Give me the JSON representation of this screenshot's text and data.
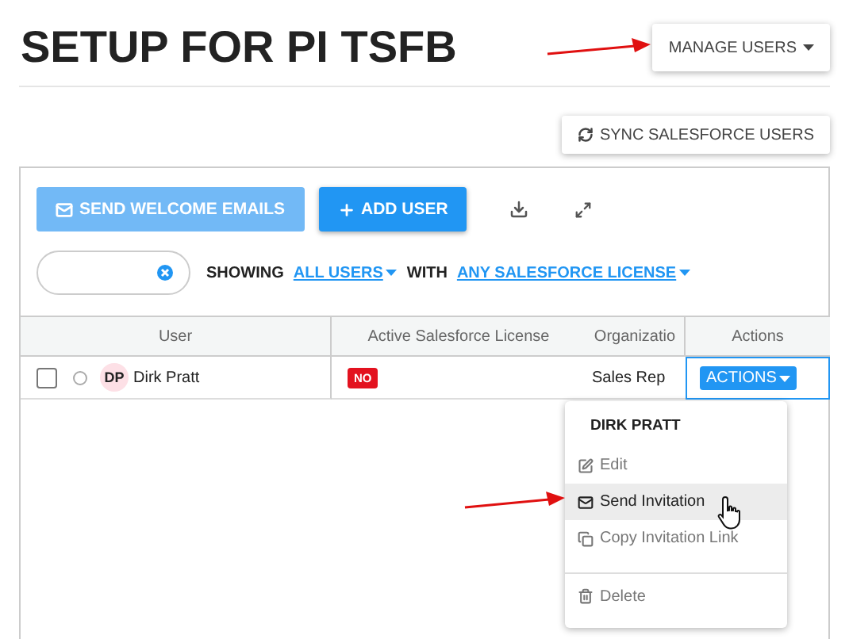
{
  "page": {
    "title": "SETUP FOR PI TSFB"
  },
  "manage_button": {
    "label": "MANAGE USERS"
  },
  "sync_button": {
    "label": "SYNC SALESFORCE USERS"
  },
  "toolbar": {
    "buttons": [
      {
        "label": "SEND WELCOME EMAILS",
        "kind": "email",
        "disabled": true
      },
      {
        "label": "ADD USER",
        "kind": "add",
        "disabled": false
      }
    ]
  },
  "filter": {
    "showing_label": "SHOWING",
    "users_filter": "ALL USERS",
    "with_label": "WITH",
    "license_filter": "ANY SALESFORCE LICENSE"
  },
  "table": {
    "columns": [
      "User",
      "Active Salesforce License",
      "Organizatio",
      "Actions"
    ],
    "rows": [
      {
        "checked": false,
        "selected": false,
        "initials": "DP",
        "name": "Dirk Pratt",
        "license": "NO",
        "organization": "Sales Rep",
        "action": "ACTIONS"
      }
    ]
  },
  "menu": {
    "header": "DIRK PRATT",
    "items": [
      {
        "kind": "edit",
        "label": "Edit",
        "selected": false,
        "separated": false
      },
      {
        "kind": "send",
        "label": "Send Invitation",
        "selected": true,
        "separated": false
      },
      {
        "kind": "copy",
        "label": "Copy Invitation Link",
        "selected": false,
        "separated": false
      },
      {
        "kind": "delete",
        "label": "Delete",
        "selected": false,
        "separated": true
      }
    ]
  }
}
